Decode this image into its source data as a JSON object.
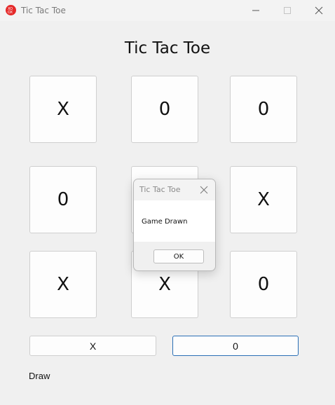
{
  "window": {
    "title": "Tic Tac Toe",
    "icon": "tic-tac-toe-app-icon",
    "accent_color": "#e52929"
  },
  "game": {
    "heading": "Tic Tac Toe",
    "board": [
      [
        "X",
        "0",
        "0"
      ],
      [
        "0",
        "",
        "X"
      ],
      [
        "X",
        "X",
        "0"
      ]
    ],
    "score_x_label": "X",
    "score_o_label": "0",
    "status": "Draw"
  },
  "dialog": {
    "title": "Tic Tac Toe",
    "message": "Game Drawn",
    "ok_label": "OK"
  }
}
